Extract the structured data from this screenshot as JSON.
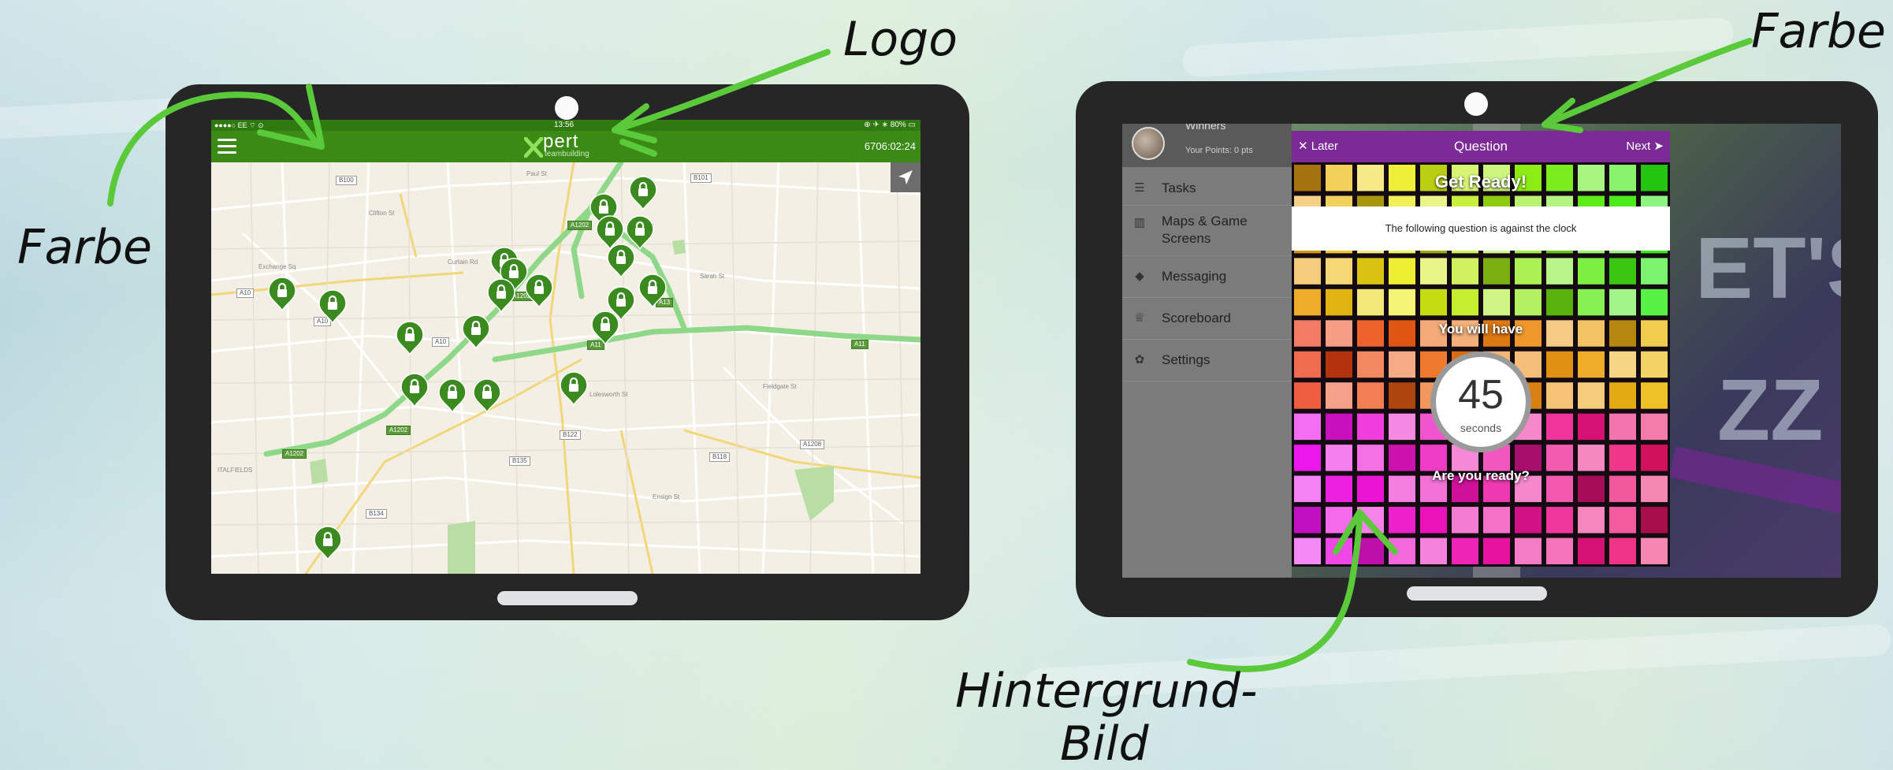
{
  "annotations": {
    "logo": "Logo",
    "farbe_left": "Farbe",
    "farbe_right": "Farbe",
    "hintergrund_line1": "Hintergrund-",
    "hintergrund_line2": "Bild"
  },
  "left_tablet": {
    "status": {
      "carrier": "●●●●○ EE ⌔ ⊙",
      "time": "13:56",
      "battery": "⊕ ✈ ∗ 80% ▭"
    },
    "logo_word": "pert",
    "logo_sub": "teambuilding",
    "timer": "6706:02:24",
    "colors": {
      "app_bar": "#3a8a15",
      "status_bar": "#2f7a10",
      "marker": "#3a8a20",
      "map_bg": "#f3efe4"
    },
    "icons": {
      "menu": "hamburger-icon",
      "locate": "location-arrow-icon",
      "marker": "lock-icon"
    }
  },
  "right_tablet": {
    "profile": {
      "name": "Winners",
      "points": "Your Points: 0 pts"
    },
    "menu": [
      {
        "label": "Tasks",
        "icon": "☰"
      },
      {
        "label": "Maps & Game",
        "label2": "Screens",
        "icon": "▥"
      },
      {
        "label": "Messaging",
        "icon": "◆"
      },
      {
        "label": "Scoreboard",
        "icon": "♕"
      },
      {
        "label": "Settings",
        "icon": "✿"
      }
    ],
    "bg_text": {
      "top": "ET'S",
      "bottom": "ZZ"
    },
    "question": {
      "later": "✕ Later",
      "title": "Question",
      "next": "Next ➤",
      "get_ready": "Get Ready!",
      "clock_note": "The following question is against the clock",
      "you_will_have": "You will have",
      "seconds_value": "45",
      "seconds_unit": "seconds",
      "are_you_ready": "Are you ready?"
    },
    "colors": {
      "header": "#7b2a96",
      "sidebar": "#7b7b7b"
    }
  }
}
